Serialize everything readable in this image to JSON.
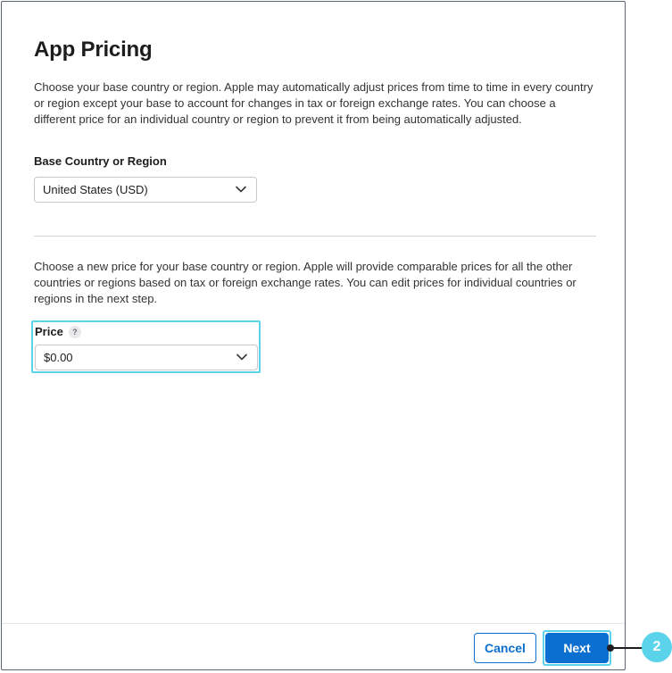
{
  "dialog": {
    "title": "App Pricing",
    "intro": "Choose your base country or region. Apple may automatically adjust prices from time to time in every country or region except your base to account for changes in tax or foreign exchange rates. You can choose a different price for an individual country or region to prevent it from being automatically adjusted.",
    "base_country": {
      "label": "Base Country or Region",
      "value": "United States (USD)"
    },
    "price_intro": "Choose a new price for your base country or region. Apple will provide comparable prices for all the other countries or regions based on tax or foreign exchange rates. You can edit prices for individual countries or regions in the next step.",
    "price": {
      "label": "Price",
      "help": "?",
      "value": "$0.00"
    },
    "buttons": {
      "cancel": "Cancel",
      "next": "Next"
    }
  },
  "callout": {
    "number": "2"
  },
  "colors": {
    "accent": "#0a6fd0",
    "highlight": "#5ad3eb"
  },
  "icons": {
    "select_chevron": "chevron-down-icon",
    "help": "help-icon"
  }
}
